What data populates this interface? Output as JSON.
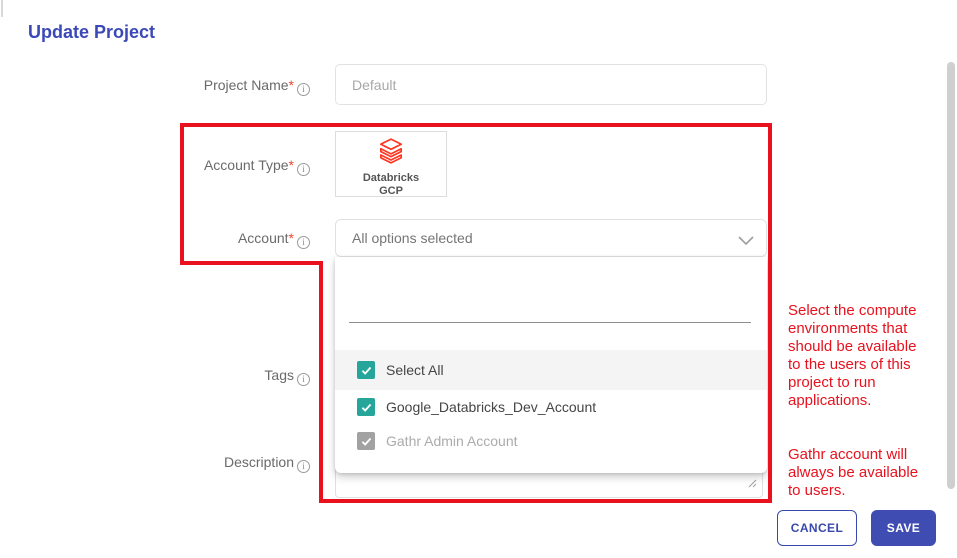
{
  "window": {
    "title": "Update Project"
  },
  "icons": {
    "info_glyph": "i"
  },
  "form": {
    "required_marker": "*",
    "project_name": {
      "label": "Project Name",
      "placeholder": "Default"
    },
    "account_type": {
      "label": "Account Type",
      "card": {
        "line1": "Databricks",
        "line2": "GCP"
      }
    },
    "account": {
      "label": "Account",
      "selected_value": "All options selected"
    },
    "tags": {
      "label": "Tags"
    },
    "description": {
      "label": "Description"
    },
    "buttons": {
      "cancel": "CANCEL",
      "save": "SAVE"
    }
  },
  "account_dropdown": {
    "search_value": "",
    "options": [
      {
        "label": "Select All",
        "checked": true,
        "disabled": false
      },
      {
        "label": "Google_Databricks_Dev_Account",
        "checked": true,
        "disabled": false
      },
      {
        "label": "Gathr Admin Account",
        "checked": true,
        "disabled": true
      }
    ]
  },
  "annotation": {
    "highlight_color": "#e8111d",
    "note1": "Select the compute\nenvironments that\nshould be available\nto the users of this\nproject to run\napplications.",
    "note2": "Gathr account will\nalways be available\nto users."
  },
  "colors": {
    "title_accent": "#3b49b8",
    "primary_button": "#3f4db3",
    "checkbox_teal": "#26a69a",
    "databricks_red": "#ff3621",
    "disabled_gray": "#a2a2a2"
  }
}
